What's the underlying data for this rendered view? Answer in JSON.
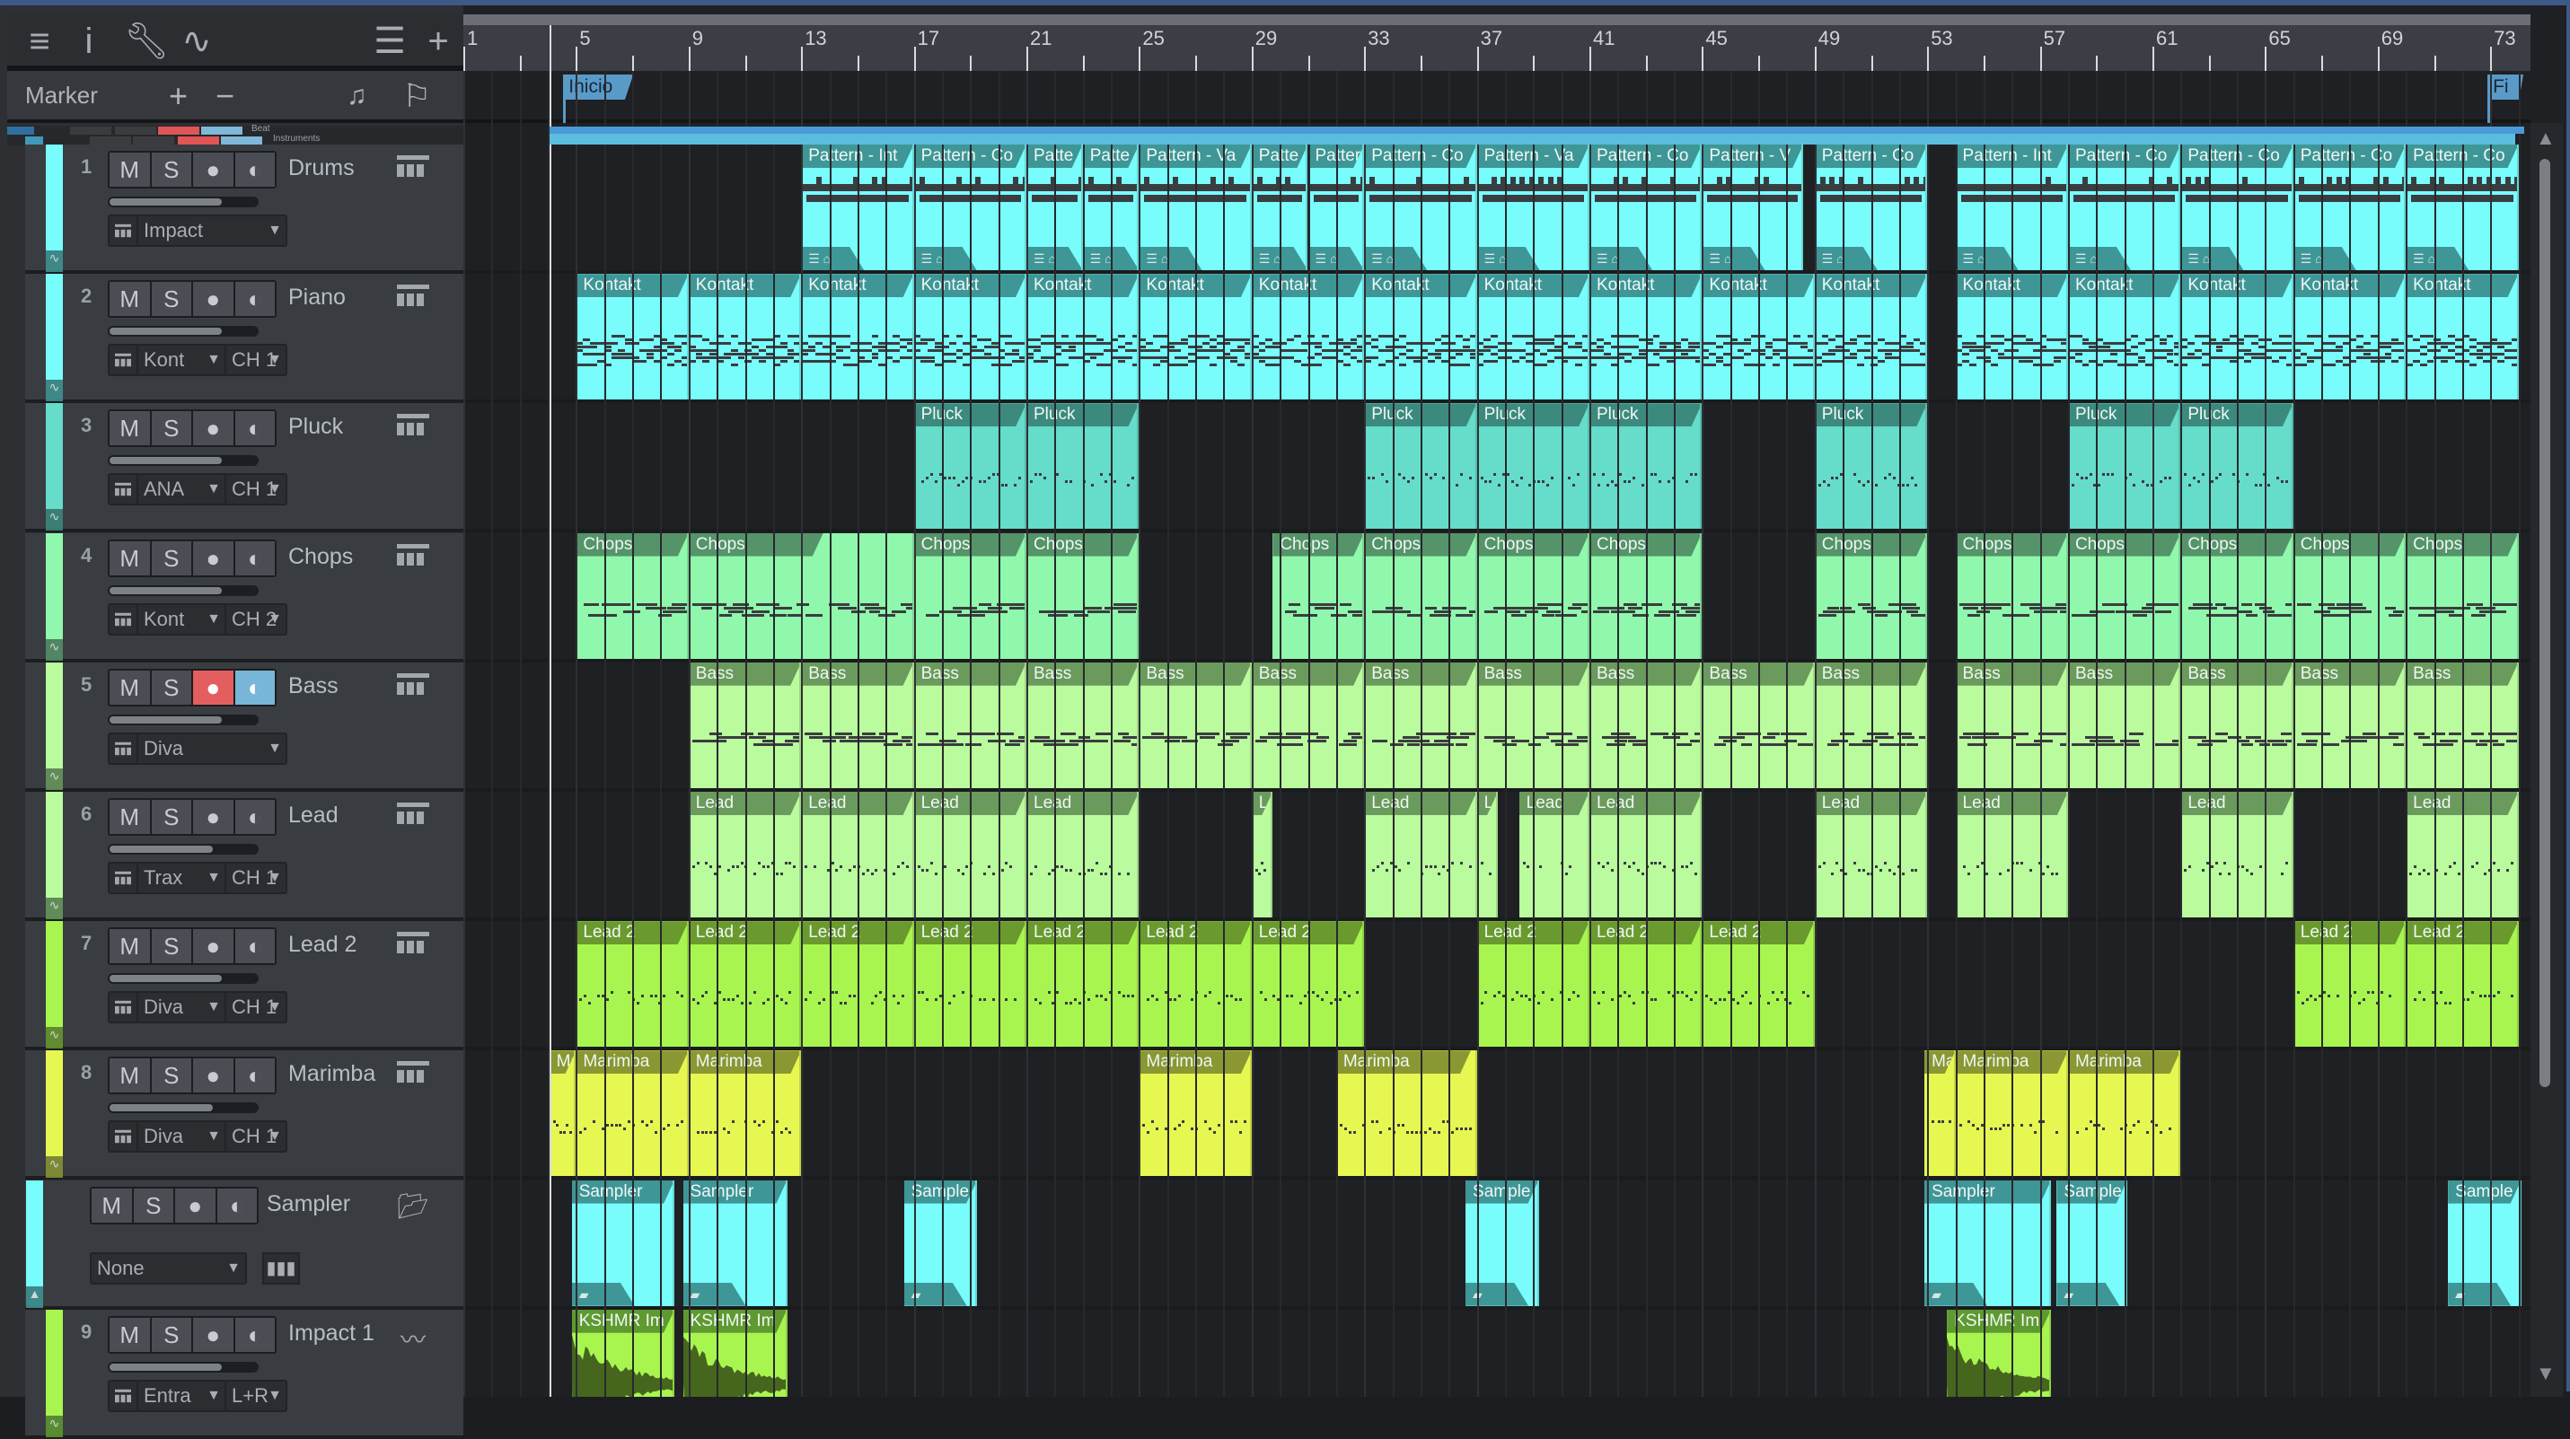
{
  "toolbar": {
    "icons": [
      "menu-icon",
      "info-icon",
      "wrench-icon",
      "automation-icon",
      "track-list-icon",
      "add-track-icon"
    ]
  },
  "marker": {
    "label": "Marker",
    "add": "+",
    "remove": "−",
    "note": "♫",
    "flag": "⚐"
  },
  "folders": [
    {
      "label": "Beat"
    },
    {
      "label": "Instruments"
    }
  ],
  "ruler": {
    "bars": [
      1,
      5,
      9,
      13,
      17,
      21,
      25,
      29,
      33,
      37,
      41,
      45,
      49,
      53,
      57,
      61,
      65,
      69,
      73
    ]
  },
  "markers": [
    {
      "label": "Inicio",
      "bar": 4.55
    },
    {
      "label": "Fi",
      "bar": 72.9
    }
  ],
  "playhead_bar": 4.05,
  "loop": {
    "start": 4.05,
    "end": 74.2
  },
  "tracks": [
    {
      "num": "1",
      "name": "Drums",
      "icon": "keyboard",
      "color": "#78fcfc",
      "hd": "#3f9696",
      "fader": 0.76,
      "inst": "Impact",
      "ch": null,
      "kind": "drums",
      "clips": [
        [
          13,
          4,
          "Pattern - Int"
        ],
        [
          17,
          4,
          "Pattern - Co"
        ],
        [
          21,
          2,
          "Patte"
        ],
        [
          23,
          2,
          "Patte"
        ],
        [
          25,
          4,
          "Pattern - Va"
        ],
        [
          29,
          2,
          "Patte"
        ],
        [
          31,
          2,
          "Patter"
        ],
        [
          33,
          4,
          "Pattern - Co"
        ],
        [
          37,
          4,
          "Pattern - Va"
        ],
        [
          41,
          4,
          "Pattern - Co"
        ],
        [
          45,
          3.6,
          "Pattern - V"
        ],
        [
          49,
          4,
          "Pattern - Co"
        ],
        [
          54,
          4,
          "Pattern - Int"
        ],
        [
          58,
          4,
          "Pattern - Co"
        ],
        [
          62,
          4,
          "Pattern - Co"
        ],
        [
          66,
          4,
          "Pattern - Co"
        ],
        [
          70,
          4,
          "Pattern - Co"
        ]
      ]
    },
    {
      "num": "2",
      "name": "Piano",
      "icon": "keyboard",
      "color": "#78fcfc",
      "hd": "#3f9696",
      "fader": 0.76,
      "inst": "Kont",
      "ch": "CH 1",
      "kind": "piano",
      "clips": [
        [
          5,
          4,
          "Kontakt"
        ],
        [
          9,
          4,
          "Kontakt"
        ],
        [
          13,
          4,
          "Kontakt"
        ],
        [
          17,
          4,
          "Kontakt"
        ],
        [
          21,
          4,
          "Kontakt"
        ],
        [
          25,
          4,
          "Kontakt"
        ],
        [
          29,
          4,
          "Kontakt"
        ],
        [
          33,
          4,
          "Kontakt"
        ],
        [
          37,
          4,
          "Kontakt"
        ],
        [
          41,
          4,
          "Kontakt"
        ],
        [
          45,
          4,
          "Kontakt"
        ],
        [
          49,
          4,
          "Kontakt"
        ],
        [
          54,
          4,
          "Kontakt"
        ],
        [
          58,
          4,
          "Kontakt"
        ],
        [
          62,
          4,
          "Kontakt"
        ],
        [
          66,
          4,
          "Kontakt"
        ],
        [
          70,
          4,
          "Kontakt"
        ]
      ]
    },
    {
      "num": "3",
      "name": "Pluck",
      "icon": "keyboard",
      "color": "#66dccb",
      "hd": "#3c8a7e",
      "fader": 0.76,
      "inst": "ANA",
      "ch": "CH 1",
      "kind": "midi",
      "clips": [
        [
          17,
          4,
          "Pluck"
        ],
        [
          21,
          4,
          "Pluck"
        ],
        [
          33,
          4,
          "Pluck"
        ],
        [
          37,
          4,
          "Pluck"
        ],
        [
          41,
          4,
          "Pluck"
        ],
        [
          49,
          4,
          "Pluck"
        ],
        [
          58,
          4,
          "Pluck"
        ],
        [
          62,
          4,
          "Pluck"
        ]
      ]
    },
    {
      "num": "4",
      "name": "Chops",
      "icon": "keyboard",
      "color": "#90f8ac",
      "hd": "#559468",
      "fader": 0.76,
      "inst": "Kont",
      "ch": "CH 2",
      "kind": "midi",
      "clips": [
        [
          5,
          4,
          "Chops"
        ],
        [
          9,
          8,
          "Chops"
        ],
        [
          17,
          4,
          "Chops"
        ],
        [
          21,
          4,
          "Chops"
        ],
        [
          29.75,
          3.25,
          "Chops"
        ],
        [
          33,
          4,
          "Chops"
        ],
        [
          37,
          4,
          "Chops"
        ],
        [
          41,
          4,
          "Chops"
        ],
        [
          49,
          4,
          "Chops"
        ],
        [
          54,
          4,
          "Chops"
        ],
        [
          58,
          4,
          "Chops"
        ],
        [
          62,
          4,
          "Chops"
        ],
        [
          66,
          4,
          "Chops"
        ],
        [
          70,
          4,
          "Chops"
        ]
      ]
    },
    {
      "num": "5",
      "name": "Bass",
      "icon": "keyboard",
      "color": "#bafb9e",
      "hd": "#6a9a5c",
      "fader": 0.76,
      "inst": "Diva",
      "ch": null,
      "rec": true,
      "mon": true,
      "kind": "midi",
      "clips": [
        [
          9,
          4,
          "Bass"
        ],
        [
          13,
          4,
          "Bass"
        ],
        [
          17,
          4,
          "Bass"
        ],
        [
          21,
          4,
          "Bass"
        ],
        [
          25,
          4,
          "Bass"
        ],
        [
          29,
          4,
          "Bass"
        ],
        [
          33,
          4,
          "Bass"
        ],
        [
          37,
          4,
          "Bass"
        ],
        [
          41,
          4,
          "Bass"
        ],
        [
          45,
          4,
          "Bass"
        ],
        [
          49,
          4,
          "Bass"
        ],
        [
          54,
          4,
          "Bass"
        ],
        [
          58,
          4,
          "Bass"
        ],
        [
          62,
          4,
          "Bass"
        ],
        [
          66,
          4,
          "Bass"
        ],
        [
          70,
          4,
          "Bass"
        ]
      ]
    },
    {
      "num": "6",
      "name": "Lead",
      "icon": "keyboard",
      "color": "#bafb9e",
      "hd": "#6a9a5c",
      "fader": 0.7,
      "inst": "Trax",
      "ch": "CH 1",
      "kind": "midi",
      "clips": [
        [
          9,
          4,
          "Lead"
        ],
        [
          13,
          4,
          "Lead"
        ],
        [
          17,
          4,
          "Lead"
        ],
        [
          21,
          4,
          "Lead"
        ],
        [
          29,
          0.75,
          "L"
        ],
        [
          33,
          4,
          "Lead"
        ],
        [
          37,
          0.75,
          "L"
        ],
        [
          38.5,
          2.5,
          "Lead"
        ],
        [
          41,
          4,
          "Lead"
        ],
        [
          49,
          4,
          "Lead"
        ],
        [
          54,
          4,
          "Lead"
        ],
        [
          62,
          4,
          "Lead"
        ],
        [
          70,
          4,
          "Lead"
        ]
      ]
    },
    {
      "num": "7",
      "name": "Lead 2",
      "icon": "keyboard",
      "color": "#a8f550",
      "hd": "#6a9a2e",
      "fader": 0.76,
      "inst": "Diva",
      "ch": "CH 1",
      "kind": "midi",
      "clips": [
        [
          5,
          4,
          "Lead 2"
        ],
        [
          9,
          4,
          "Lead 2"
        ],
        [
          13,
          4,
          "Lead 2"
        ],
        [
          17,
          4,
          "Lead 2"
        ],
        [
          21,
          4,
          "Lead 2"
        ],
        [
          25,
          4,
          "Lead 2"
        ],
        [
          29,
          4,
          "Lead 2"
        ],
        [
          37,
          4,
          "Lead 2"
        ],
        [
          41,
          4,
          "Lead 2"
        ],
        [
          45,
          4,
          "Lead 2"
        ],
        [
          66,
          4,
          "Lead 2"
        ],
        [
          70,
          4,
          "Lead 2"
        ]
      ]
    },
    {
      "num": "8",
      "name": "Marimba",
      "icon": "keyboard",
      "color": "#e6f752",
      "hd": "#8a9732",
      "fader": 0.7,
      "inst": "Diva",
      "ch": "CH 1",
      "kind": "midi",
      "clips": [
        [
          4.05,
          0.95,
          "Ma"
        ],
        [
          5,
          4,
          "Marimba"
        ],
        [
          9,
          4,
          "Marimba"
        ],
        [
          25,
          4,
          "Marimba"
        ],
        [
          32,
          5,
          "Marimba"
        ],
        [
          52.9,
          1.1,
          "Ma"
        ],
        [
          54,
          4,
          "Marimba"
        ],
        [
          58,
          4,
          "Marimba"
        ]
      ]
    },
    {
      "num": "",
      "name": "Sampler",
      "icon": "folder",
      "color": "#78fcfc",
      "hd": "#3f9696",
      "fader": null,
      "inst": "None",
      "ch": null,
      "kind": "sampler",
      "clips": [
        [
          4.85,
          3.65,
          "Sampler"
        ],
        [
          8.8,
          3.7,
          "Sampler"
        ],
        [
          16.65,
          2.6,
          "Sample"
        ],
        [
          36.6,
          2.6,
          "Sample"
        ],
        [
          52.9,
          4.5,
          "Sampler"
        ],
        [
          57.6,
          2.5,
          "Sample"
        ],
        [
          71.5,
          2.6,
          "Sample"
        ]
      ]
    },
    {
      "num": "9",
      "name": "Impact 1",
      "icon": "waveform",
      "color": "#a8f550",
      "hd": "#5f9a30",
      "fader": 0.76,
      "inst": "Entra",
      "ch": "L+R",
      "kind": "audio",
      "clips": [
        [
          4.85,
          3.65,
          "KSHMR Im"
        ],
        [
          8.8,
          3.7,
          "KSHMR Im"
        ],
        [
          53.7,
          3.7,
          "KSHMR Im"
        ]
      ]
    }
  ]
}
